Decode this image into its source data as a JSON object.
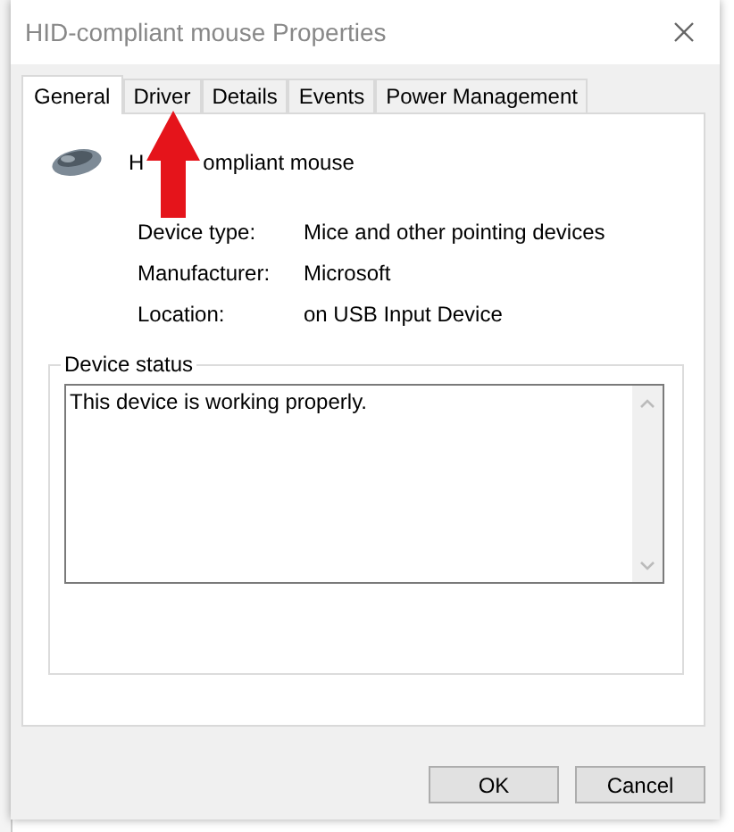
{
  "window": {
    "title": "HID-compliant mouse Properties"
  },
  "tabs": [
    {
      "label": "General",
      "selected": true
    },
    {
      "label": "Driver",
      "selected": false
    },
    {
      "label": "Details",
      "selected": false
    },
    {
      "label": "Events",
      "selected": false
    },
    {
      "label": "Power Management",
      "selected": false
    }
  ],
  "device": {
    "name_parts": [
      "H",
      "ompliant mouse"
    ]
  },
  "properties": [
    {
      "label": "Device type:",
      "value": "Mice and other pointing devices"
    },
    {
      "label": "Manufacturer:",
      "value": "Microsoft"
    },
    {
      "label": "Location:",
      "value": "on USB Input Device"
    }
  ],
  "device_status": {
    "label": "Device status",
    "text": "This device is working properly."
  },
  "buttons": [
    "OK",
    "Cancel"
  ]
}
